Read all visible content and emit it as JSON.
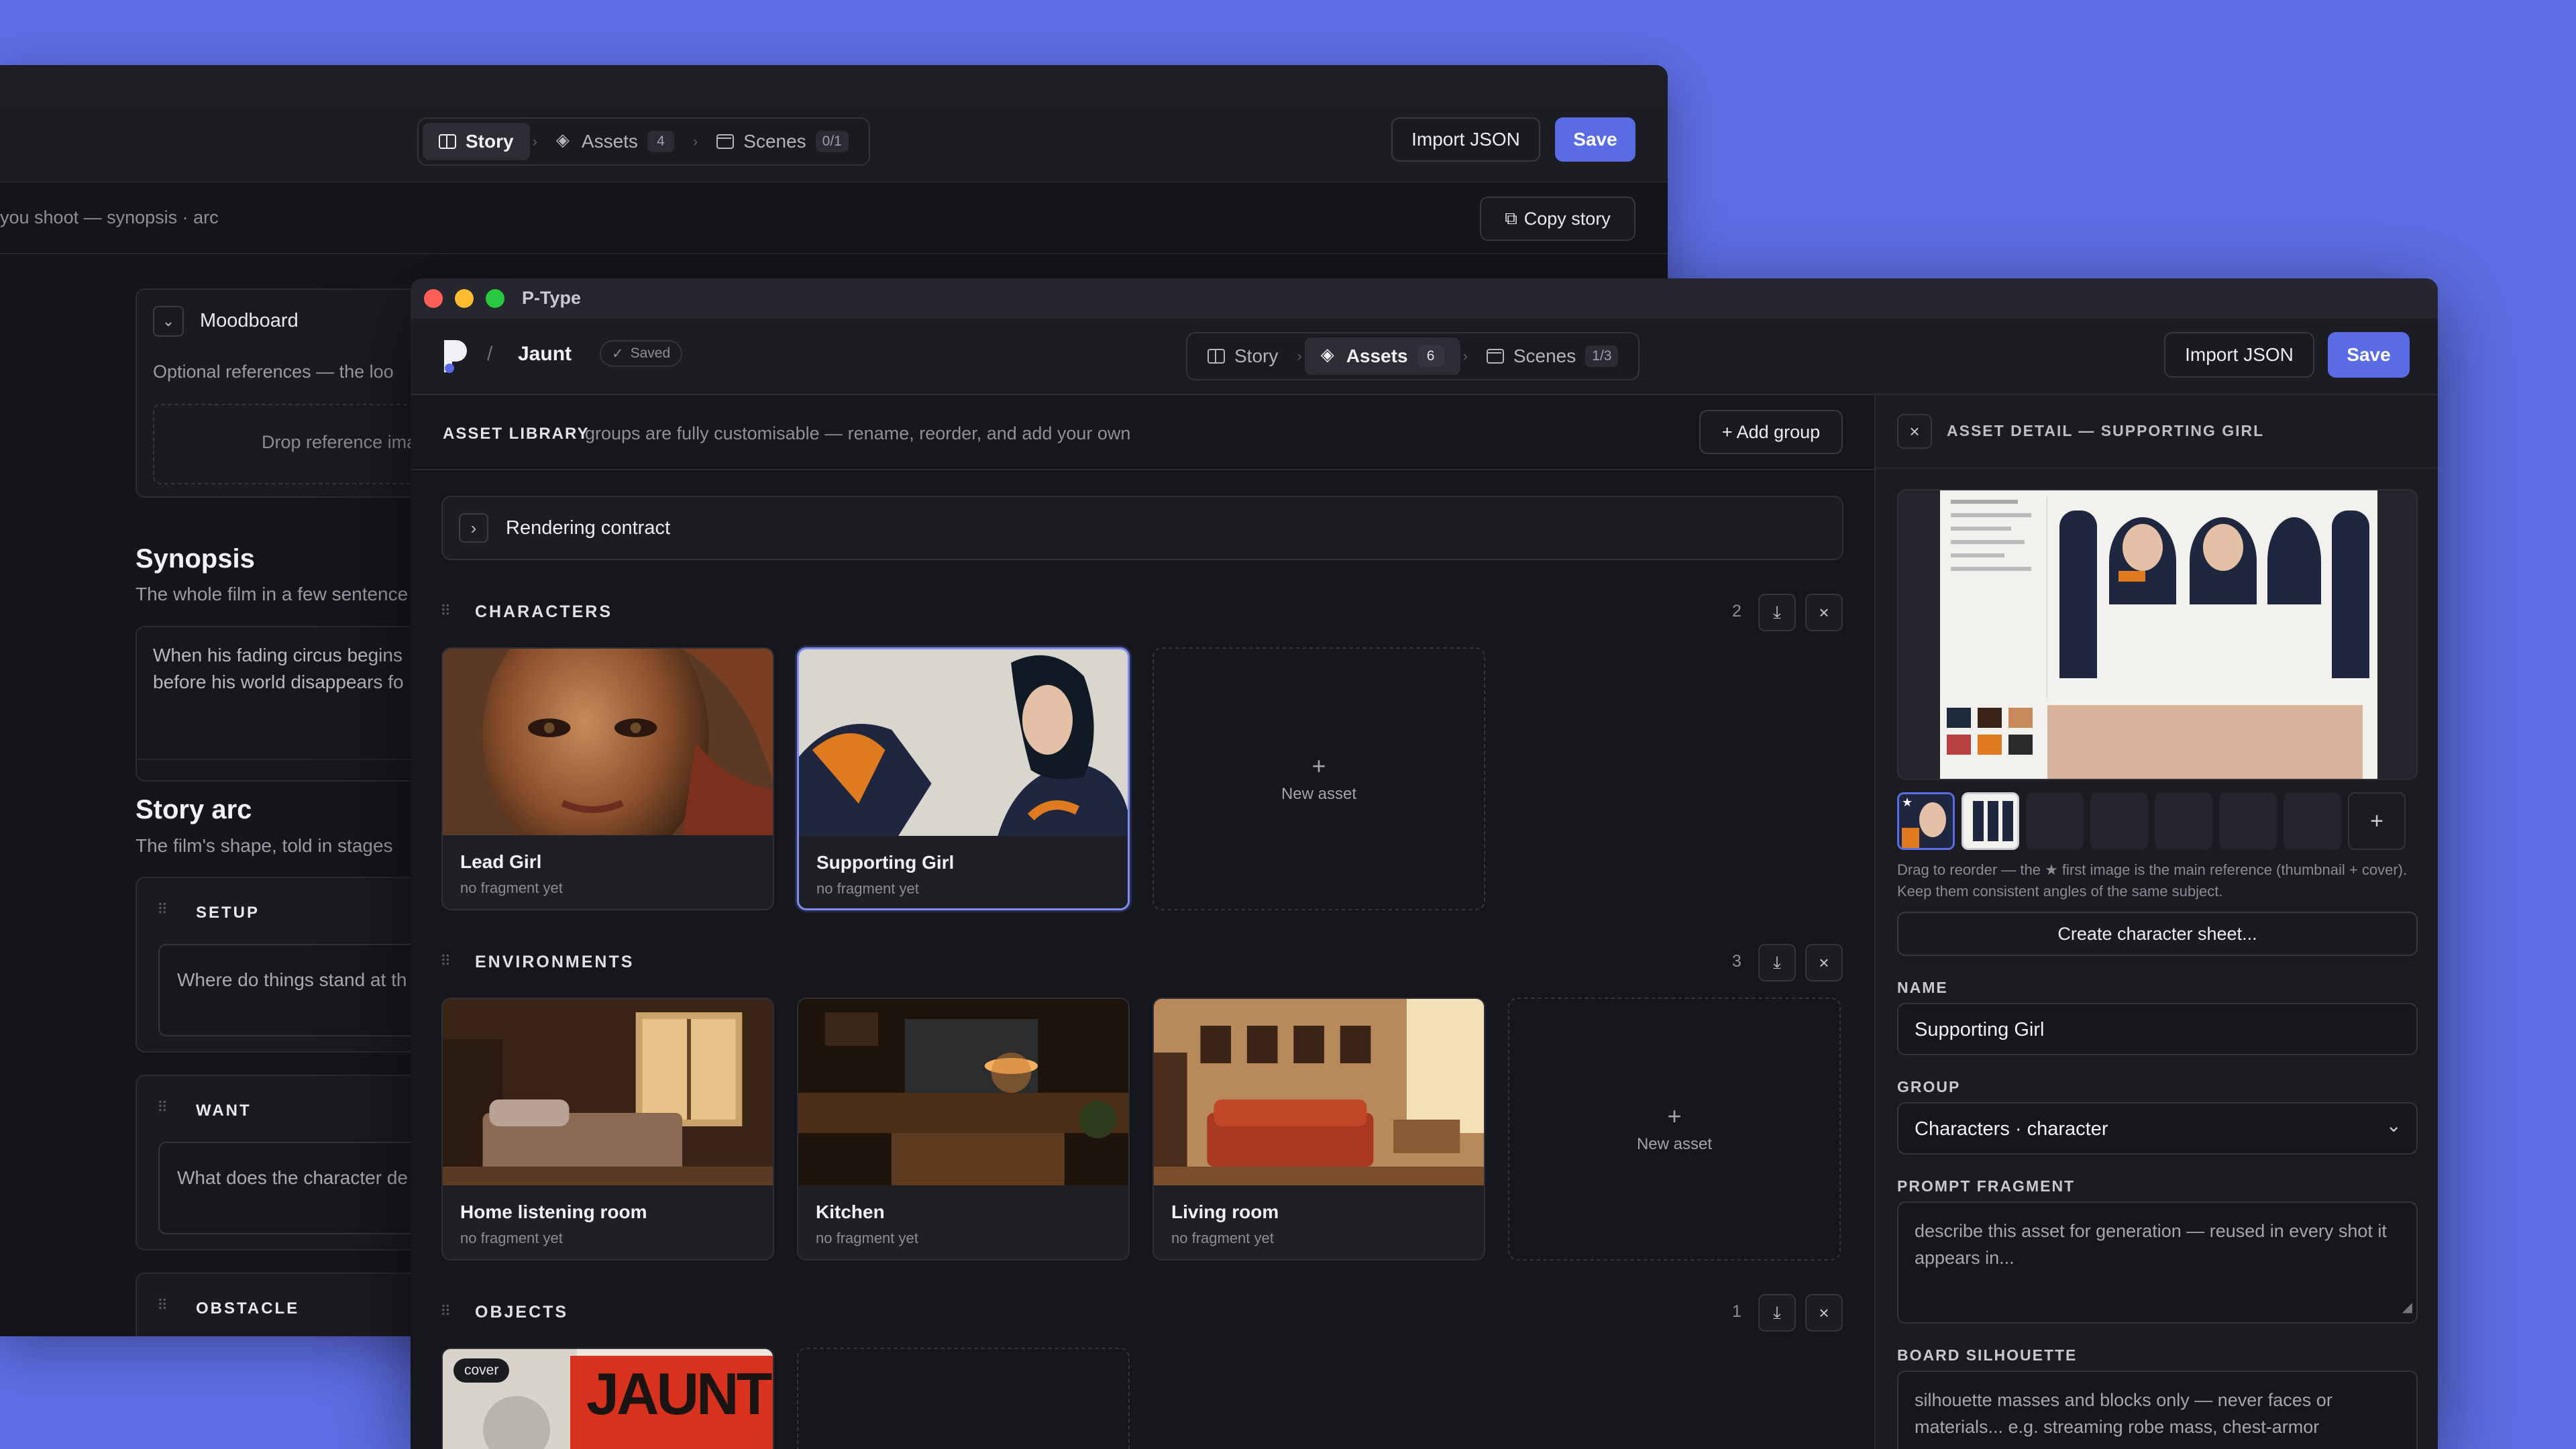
{
  "back_window": {
    "tabs": [
      {
        "label": "Story",
        "count": ""
      },
      {
        "label": "Assets",
        "count": "4"
      },
      {
        "label": "Scenes",
        "count": "0/1"
      }
    ],
    "import_label": "Import JSON",
    "save_label": "Save",
    "subtitle": "you shoot — synopsis · arc",
    "copy_story_label": "Copy story",
    "moodboard": {
      "title": "Moodboard",
      "hint": "Optional references — the loo",
      "drop": "Drop reference ima"
    },
    "synopsis": {
      "title": "Synopsis",
      "hint": "The whole film in a few sentence",
      "text_line1": "When his fading circus begins",
      "text_line2": "before his world disappears fo"
    },
    "story_arc": {
      "title": "Story arc",
      "hint": "The film's shape, told in stages",
      "stages": [
        {
          "label": "SETUP",
          "placeholder": "Where do things stand at th"
        },
        {
          "label": "WANT",
          "placeholder": "What does the character de"
        },
        {
          "label": "OBSTACLE",
          "placeholder": ""
        }
      ]
    }
  },
  "front_window": {
    "title": "P-Type",
    "breadcrumb_sep": "/",
    "project": "Jaunt",
    "saved": "Saved",
    "tabs": [
      {
        "label": "Story",
        "count": ""
      },
      {
        "label": "Assets",
        "count": "6"
      },
      {
        "label": "Scenes",
        "count": "1/3"
      }
    ],
    "import_label": "Import JSON",
    "save_label": "Save",
    "library": {
      "title": "ASSET LIBRARY",
      "hint": "groups are fully customisable — rename, reorder, and add your own",
      "add_group": "+ Add group",
      "rendering_contract": "Rendering contract"
    },
    "groups": [
      {
        "title": "CHARACTERS",
        "count": "2",
        "assets": [
          {
            "name": "Lead Girl",
            "fragment": "no fragment yet"
          },
          {
            "name": "Supporting Girl",
            "fragment": "no fragment yet"
          }
        ]
      },
      {
        "title": "ENVIRONMENTS",
        "count": "3",
        "assets": [
          {
            "name": "Home listening room",
            "fragment": "no fragment yet"
          },
          {
            "name": "Kitchen",
            "fragment": "no fragment yet"
          },
          {
            "name": "Living room",
            "fragment": "no fragment yet"
          }
        ]
      },
      {
        "title": "OBJECTS",
        "count": "1",
        "assets": [
          {
            "name": "",
            "fragment": "",
            "badge": "cover",
            "poster_text": "JAUNT"
          }
        ]
      }
    ],
    "new_asset": "New asset",
    "new_asset_plus": "+",
    "detail": {
      "title": "ASSET DETAIL — SUPPORTING GIRL",
      "close": "×",
      "add_image": "+",
      "drag_hint": "Drag to reorder — the ★ first image is the main reference (thumbnail + cover). Keep them consistent angles of the same subject.",
      "create_sheet": "Create character sheet...",
      "name_label": "NAME",
      "name_value": "Supporting Girl",
      "group_label": "GROUP",
      "group_value": "Characters · character",
      "prompt_label": "PROMPT FRAGMENT",
      "prompt_placeholder": "describe this asset for generation — reused in every shot it appears in...",
      "silhouette_label": "BOARD SILHOUETTE",
      "silhouette_placeholder": "silhouette masses and blocks only — never faces or materials... e.g. streaming robe mass, chest-armor"
    }
  },
  "colors": {
    "desktop": "#5e6fe6",
    "accent": "#5a6be6",
    "selected_border": "#7e8cf0"
  }
}
